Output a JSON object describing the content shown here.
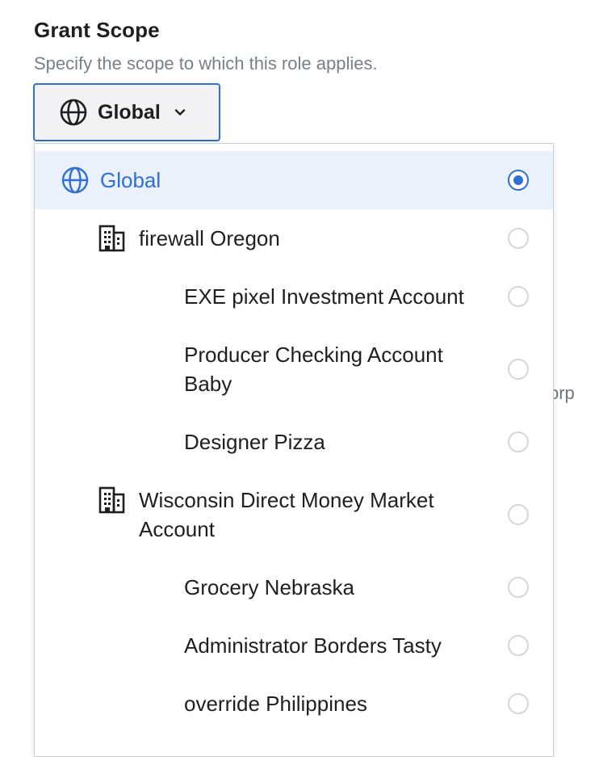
{
  "section": {
    "title": "Grant Scope",
    "subtitle": "Specify the scope to which this role applies."
  },
  "scope_select": {
    "value": "Global",
    "icon": "globe-icon",
    "chevron_icon": "chevron-down-icon"
  },
  "background": {
    "partial_text": "orp"
  },
  "dropdown": {
    "options": [
      {
        "label": "Global",
        "level": 0,
        "icon": "globe-icon",
        "selected": true
      },
      {
        "label": "firewall Oregon",
        "level": 1,
        "icon": "building-icon",
        "selected": false
      },
      {
        "label": "EXE pixel Investment Account",
        "level": 2,
        "selected": false
      },
      {
        "label": "Producer Checking Account Baby",
        "level": 2,
        "selected": false
      },
      {
        "label": "Designer Pizza",
        "level": 2,
        "selected": false
      },
      {
        "label": "Wisconsin Direct Money Market Account",
        "level": 1,
        "icon": "building-icon",
        "selected": false
      },
      {
        "label": "Grocery Nebraska",
        "level": 2,
        "selected": false
      },
      {
        "label": "Administrator Borders Tasty",
        "level": 2,
        "selected": false
      },
      {
        "label": "override Philippines",
        "level": 2,
        "selected": false
      }
    ]
  },
  "colors": {
    "accent": "#2f6fd6",
    "selected_row_bg": "#eaf1fb",
    "muted_text": "#7a7f87"
  }
}
